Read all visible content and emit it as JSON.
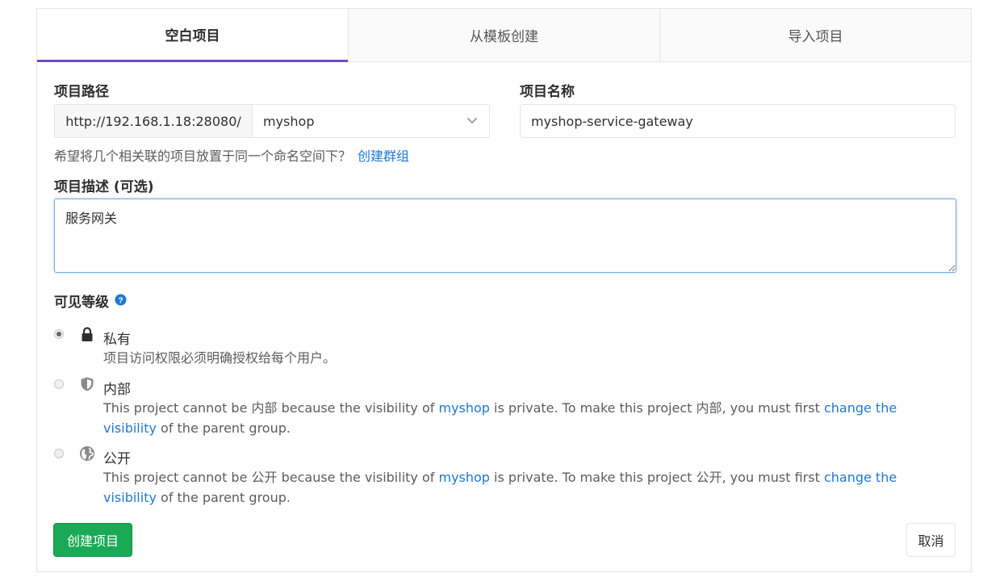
{
  "tabs": [
    {
      "label": "空白项目",
      "active": true
    },
    {
      "label": "从模板创建",
      "active": false
    },
    {
      "label": "导入项目",
      "active": false
    }
  ],
  "form": {
    "path_label": "项目路径",
    "url_prefix": "http://192.168.1.18:28080/",
    "namespace": "myshop",
    "name_label": "项目名称",
    "name_value": "myshop-service-gateway",
    "namespace_hint": "希望将几个相关联的项目放置于同一个命名空间下？",
    "create_group_link": "创建群组",
    "description_label": "项目描述 (可选)",
    "description_value": "服务网关",
    "visibility_label": "可见等级"
  },
  "visibility": {
    "private": {
      "title": "私有",
      "description": "项目访问权限必须明确授权给每个用户。",
      "selected": true,
      "icon": "lock-icon"
    },
    "internal": {
      "title": "内部",
      "desc_part1": "This project cannot be 内部 because the visibility of ",
      "group_link": "myshop",
      "desc_part2": " is private. To make this project 内部, you must first ",
      "change_link": "change the visibility",
      "desc_part3": " of the parent group.",
      "selected": false,
      "icon": "shield-icon"
    },
    "public": {
      "title": "公开",
      "desc_part1": "This project cannot be 公开 because the visibility of ",
      "group_link": "myshop",
      "desc_part2": " is private. To make this project 公开, you must first ",
      "change_link": "change the visibility",
      "desc_part3": " of the parent group.",
      "selected": false,
      "icon": "globe-icon"
    }
  },
  "buttons": {
    "create": "创建项目",
    "cancel": "取消"
  },
  "colors": {
    "active_tab_underline": "#6b4fbb",
    "link": "#1f78d1",
    "create_button": "#1aaa55"
  }
}
